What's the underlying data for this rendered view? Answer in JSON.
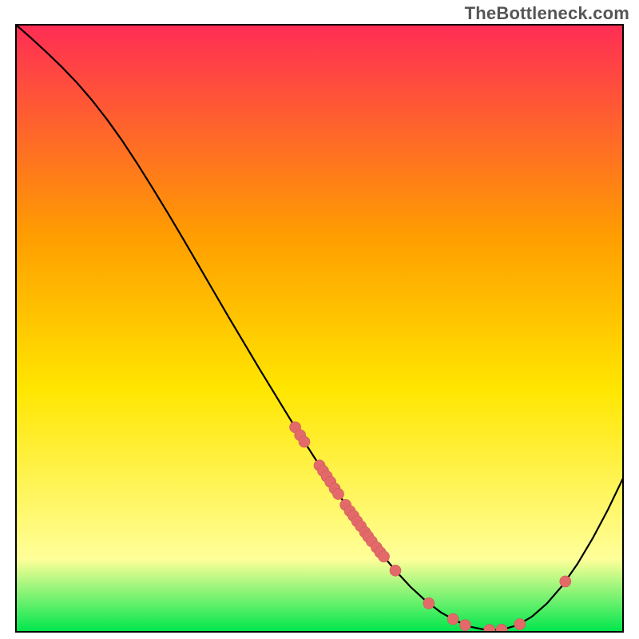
{
  "watermark": "TheBottleneck.com",
  "colors": {
    "gradient_top": "#ff2d55",
    "gradient_mid1": "#ff9e00",
    "gradient_mid2": "#ffe600",
    "gradient_mid3": "#ffff99",
    "gradient_bottom": "#00e64d",
    "curve": "#000000",
    "frame": "#000000",
    "marker_fill": "#e46a6a",
    "marker_stroke": "#cc5a5a"
  },
  "chart_data": {
    "type": "line",
    "title": "",
    "xlabel": "",
    "ylabel": "",
    "xlim": [
      0,
      100
    ],
    "ylim": [
      0,
      100
    ],
    "curve": [
      {
        "x": 0.0,
        "y": 100.0
      },
      {
        "x": 2.5,
        "y": 97.8
      },
      {
        "x": 5.0,
        "y": 95.5
      },
      {
        "x": 7.5,
        "y": 93.1
      },
      {
        "x": 10.0,
        "y": 90.5
      },
      {
        "x": 12.5,
        "y": 87.6
      },
      {
        "x": 15.0,
        "y": 84.4
      },
      {
        "x": 17.5,
        "y": 80.9
      },
      {
        "x": 20.0,
        "y": 77.1
      },
      {
        "x": 22.5,
        "y": 73.1
      },
      {
        "x": 25.0,
        "y": 69.0
      },
      {
        "x": 27.5,
        "y": 64.8
      },
      {
        "x": 30.0,
        "y": 60.5
      },
      {
        "x": 32.5,
        "y": 56.2
      },
      {
        "x": 35.0,
        "y": 51.9
      },
      {
        "x": 37.5,
        "y": 47.7
      },
      {
        "x": 40.0,
        "y": 43.5
      },
      {
        "x": 42.5,
        "y": 39.4
      },
      {
        "x": 45.0,
        "y": 35.3
      },
      {
        "x": 47.5,
        "y": 31.3
      },
      {
        "x": 50.0,
        "y": 27.4
      },
      {
        "x": 52.5,
        "y": 23.6
      },
      {
        "x": 55.0,
        "y": 19.9
      },
      {
        "x": 57.5,
        "y": 16.4
      },
      {
        "x": 60.0,
        "y": 13.1
      },
      {
        "x": 62.5,
        "y": 10.1
      },
      {
        "x": 65.0,
        "y": 7.4
      },
      {
        "x": 67.5,
        "y": 5.1
      },
      {
        "x": 70.0,
        "y": 3.2
      },
      {
        "x": 72.5,
        "y": 1.8
      },
      {
        "x": 75.0,
        "y": 0.8
      },
      {
        "x": 77.5,
        "y": 0.3
      },
      {
        "x": 80.0,
        "y": 0.35
      },
      {
        "x": 82.5,
        "y": 1.05
      },
      {
        "x": 85.0,
        "y": 2.5
      },
      {
        "x": 87.5,
        "y": 4.7
      },
      {
        "x": 90.0,
        "y": 7.6
      },
      {
        "x": 92.5,
        "y": 11.2
      },
      {
        "x": 95.0,
        "y": 15.4
      },
      {
        "x": 97.5,
        "y": 20.1
      },
      {
        "x": 100.0,
        "y": 25.3
      }
    ],
    "markers": [
      {
        "x": 46.0,
        "y": 33.7
      },
      {
        "x": 46.8,
        "y": 32.4
      },
      {
        "x": 47.5,
        "y": 31.3
      },
      {
        "x": 50.0,
        "y": 27.4
      },
      {
        "x": 50.6,
        "y": 26.5
      },
      {
        "x": 51.2,
        "y": 25.6
      },
      {
        "x": 51.8,
        "y": 24.7
      },
      {
        "x": 52.5,
        "y": 23.6
      },
      {
        "x": 53.1,
        "y": 22.7
      },
      {
        "x": 54.3,
        "y": 20.9
      },
      {
        "x": 55.0,
        "y": 19.9
      },
      {
        "x": 55.6,
        "y": 19.1
      },
      {
        "x": 56.2,
        "y": 18.2
      },
      {
        "x": 56.8,
        "y": 17.4
      },
      {
        "x": 57.5,
        "y": 16.4
      },
      {
        "x": 58.0,
        "y": 15.7
      },
      {
        "x": 58.6,
        "y": 14.9
      },
      {
        "x": 59.4,
        "y": 13.9
      },
      {
        "x": 60.0,
        "y": 13.1
      },
      {
        "x": 60.6,
        "y": 12.4
      },
      {
        "x": 62.5,
        "y": 10.1
      },
      {
        "x": 68.0,
        "y": 4.7
      },
      {
        "x": 72.0,
        "y": 2.1
      },
      {
        "x": 74.0,
        "y": 1.1
      },
      {
        "x": 78.0,
        "y": 0.3
      },
      {
        "x": 80.0,
        "y": 0.35
      },
      {
        "x": 83.0,
        "y": 1.25
      },
      {
        "x": 90.5,
        "y": 8.3
      }
    ]
  }
}
